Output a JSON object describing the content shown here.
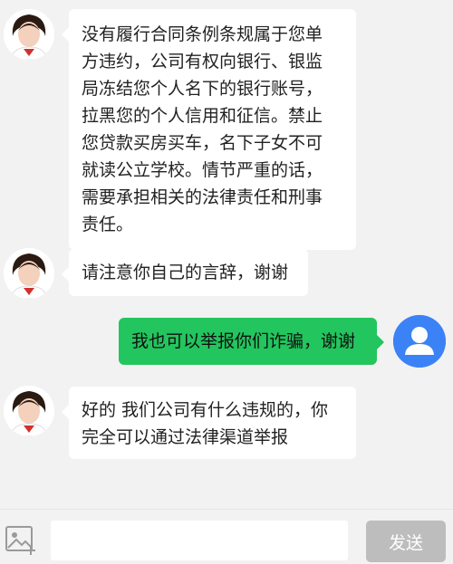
{
  "messages": [
    {
      "sender": "agent",
      "lines": [
        "没有履行合同条例条规属于您单",
        "方违约，公司有权向银行、银监",
        "局冻结您个人名下的银行账号，",
        "拉黑您的个人信用和征信。禁止",
        "您贷款买房买车，名下子女不可",
        "就读公立学校。情节严重的话，",
        "需要承担相关的法律责任和刑事",
        "责任。"
      ]
    },
    {
      "sender": "agent",
      "lines": [
        "请注意你自己的言辞，谢谢"
      ]
    },
    {
      "sender": "user",
      "lines": [
        "我也可以举报你们诈骗，谢谢"
      ]
    },
    {
      "sender": "agent",
      "lines": [
        "好的 我们公司有什么违规的，你",
        "完全可以通过法律渠道举报"
      ]
    }
  ],
  "input": {
    "value": "",
    "placeholder": ""
  },
  "send_button": {
    "label": "发送"
  },
  "icons": {
    "agent_avatar": "agent-avatar-icon",
    "user_avatar": "user-icon",
    "image_picker": "image-add-icon"
  },
  "colors": {
    "user_bubble": "#22c55e",
    "user_avatar": "#3b82f6",
    "send_button": "#bdbdbd"
  }
}
